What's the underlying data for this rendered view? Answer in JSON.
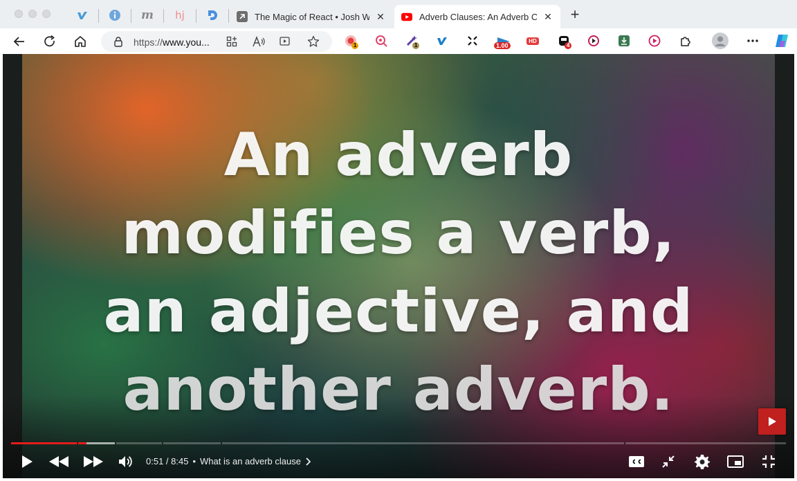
{
  "tabs": [
    {
      "title": "The Magic of React • Josh W Comeau",
      "icon": "link-arrow-icon",
      "active": false
    },
    {
      "title": "Adverb Clauses: An Adverb Clause",
      "icon": "youtube-icon",
      "active": true
    }
  ],
  "pinned_tabs": [
    "vimeo-icon",
    "info-icon",
    "m-icon",
    "hj-icon",
    "d-icon"
  ],
  "pinned_text": {
    "m": "m",
    "hj": "hj"
  },
  "toolbar": {
    "url": "https://www.you...",
    "url_scheme": "https://",
    "url_host": "www.you..."
  },
  "extensions": {
    "badge_record": "1",
    "badge_puzzle": "1",
    "badge_speed": "1.00",
    "badge_hd": "HD",
    "badge_block": "4"
  },
  "video": {
    "text_lines": [
      "An adverb",
      "modifies a verb,",
      "an adjective, and",
      "another adverb."
    ],
    "current_time": "0:51",
    "duration": "8:45",
    "time_display": "0:51 / 8:45",
    "separator": "•",
    "chapter": "What is an adverb clause",
    "progress_fraction": 0.097,
    "buffered_fraction": 0.134
  },
  "colors": {
    "tabstrip_bg": "#eceff1",
    "youtube_red": "#e51c1c",
    "logo_red": "#c0201e"
  }
}
